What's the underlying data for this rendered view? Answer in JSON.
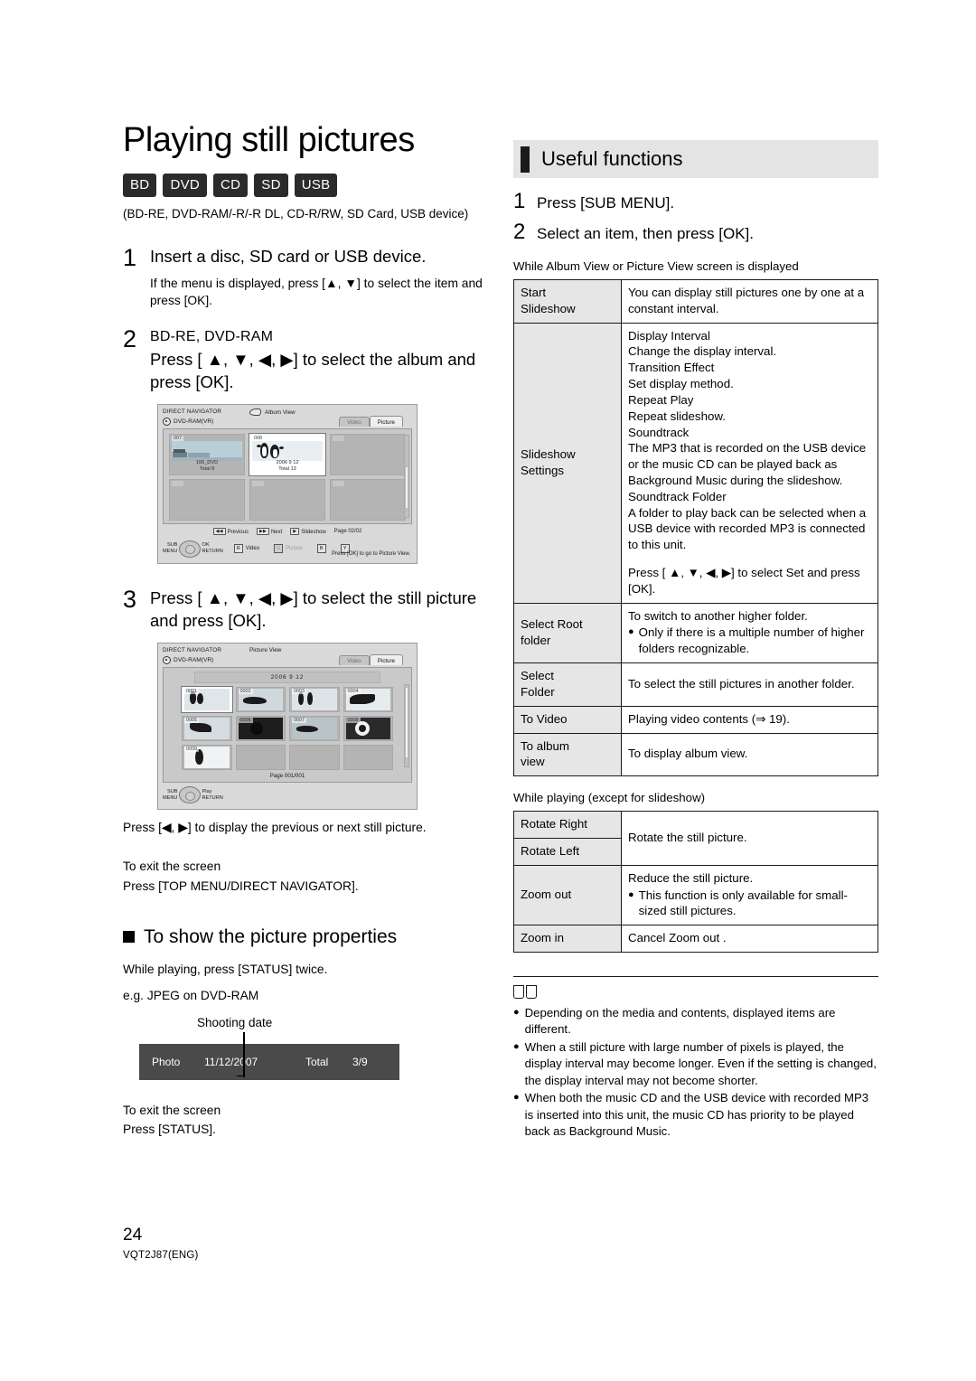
{
  "footer": {
    "page_number": "24",
    "doc_id": "VQT2J87(ENG)"
  },
  "left": {
    "title": "Playing still pictures",
    "badges": [
      "BD",
      "DVD",
      "CD",
      "SD",
      "USB"
    ],
    "media_note": "(BD-RE, DVD-RAM/-R/-R DL, CD-R/RW, SD Card, USB device)",
    "step1": {
      "number": "1",
      "heading": "Insert a disc, SD card or USB device.",
      "sub": "If the menu is displayed, press [▲, ▼] to select the item and press [OK]."
    },
    "step2": {
      "number": "2",
      "heading_small": "BD-RE, DVD-RAM",
      "heading": "Press [ ▲, ▼, ◀, ▶] to select the album and press [OK]."
    },
    "step3": {
      "number": "3",
      "heading": "Press [ ▲, ▼, ◀, ▶] to select the still picture and press [OK].",
      "after": "Press [◀, ▶] to display the previous or next still picture."
    },
    "exit1": {
      "line1": "To exit the screen",
      "line2": "Press [TOP MENU/DIRECT NAVIGATOR]."
    },
    "props_heading": "To show the picture properties",
    "props_intro": "While playing, press [STATUS] twice.",
    "props_eg": "e.g. JPEG on DVD-RAM",
    "callout": "Shooting date",
    "statusbar": {
      "label": "Photo",
      "date": "11/12/2007",
      "total_label": "Total",
      "total_value": "3/9"
    },
    "exit2": {
      "line1": "To exit the screen",
      "line2": "Press [STATUS]."
    },
    "album_shot": {
      "app_title": "DIRECT NAVIGATOR",
      "view_label": "Album View",
      "disc_label": "DVD-RAM(VR)",
      "tabs": [
        "Video",
        "Picture"
      ],
      "active_tab": "Picture",
      "albums": [
        {
          "no": "007",
          "line1": "106_DVD",
          "line2": "Total 8",
          "selected": false
        },
        {
          "no": "008",
          "line1": "2006  9  12",
          "line2": "Total 13",
          "selected": true
        }
      ],
      "hints": [
        {
          "key": "◀◀",
          "label": "Previous"
        },
        {
          "key": "▶▶",
          "label": "Next"
        },
        {
          "key": "▶",
          "label": "Slideshow"
        }
      ],
      "page_label": "Page  02/02",
      "submenu_line1": "SUB",
      "submenu_line2": "MENU",
      "ok_label": "OK",
      "return_label": "RETURN",
      "color_keys": [
        {
          "sq": "R",
          "label": "Video",
          "dim": false
        },
        {
          "sq": "G",
          "label": "Picture",
          "dim": true
        },
        {
          "sq": "B",
          "label": "",
          "dim": false
        },
        {
          "sq": "Y",
          "label": "",
          "dim": false
        }
      ],
      "foot_note": "Press [OK] to go to Picture View."
    },
    "picture_shot": {
      "app_title": "DIRECT NAVIGATOR",
      "view_label": "Picture View",
      "disc_label": "DVD-RAM(VR)",
      "tabs": [
        "Video",
        "Picture"
      ],
      "active_tab": "Picture",
      "date_bar": "2006  9  12",
      "thumb_numbers": [
        "0001",
        "0002",
        "0003",
        "0004",
        "0005",
        "0006",
        "0007",
        "0008",
        "0009"
      ],
      "page_label": "Page  001/001",
      "submenu_line1": "SUB",
      "submenu_line2": "MENU",
      "play_label": "Play",
      "return_label": "RETURN"
    }
  },
  "right": {
    "section_title": "Useful functions",
    "step1": {
      "number": "1",
      "text": "Press [SUB MENU]."
    },
    "step2": {
      "number": "2",
      "text": "Select an item, then press [OK]."
    },
    "cond1": "While  Album View  or  Picture View  screen is displayed",
    "table1": [
      {
        "key": "Start Slideshow",
        "lines": [
          "You can display still pictures one by one at a constant interval."
        ]
      },
      {
        "key": "Slideshow Settings",
        "lines": [
          "Display Interval",
          "Change the display interval.",
          "Transition Effect",
          "Set display method.",
          "Repeat Play",
          "Repeat slideshow.",
          "Soundtrack",
          "The MP3 that is recorded on the USB device or the music CD can be played back as Background Music during the slideshow.",
          "Soundtrack Folder",
          "A folder to play back can be selected when a USB device with recorded MP3 is connected to this unit.",
          "",
          "Press [ ▲, ▼, ◀, ▶] to select  Set  and press [OK]."
        ]
      },
      {
        "key": "Select Root folder",
        "lines": [
          "To switch to another higher folder."
        ],
        "bullets": [
          "Only if there is a multiple number of higher folders recognizable."
        ]
      },
      {
        "key": "Select Folder",
        "lines": [
          "To select the still pictures in another folder."
        ]
      },
      {
        "key": "To Video",
        "lines": [
          "Playing video contents (⇒ 19)."
        ]
      },
      {
        "key": "To album view",
        "lines": [
          "To display album view."
        ]
      }
    ],
    "cond2": "While playing (except for slideshow)",
    "table2": {
      "rotate_right": "Rotate Right",
      "rotate_left": "Rotate Left",
      "rotate_desc": "Rotate the still picture.",
      "zoom_out_key": "Zoom out",
      "zoom_out_desc": "Reduce the still picture.",
      "zoom_out_bullet": "This function is only available for small-sized still pictures.",
      "zoom_in_key": "Zoom in",
      "zoom_in_desc": "Cancel  Zoom out ."
    },
    "notes": [
      "Depending on the media and contents, displayed items are different.",
      "When a still picture with large number of pixels is played, the display interval may become longer. Even if the setting is changed, the display interval may not become shorter.",
      "When both the music CD and the USB device with recorded MP3 is inserted into this unit, the music CD has priority to be played back as Background Music."
    ]
  }
}
